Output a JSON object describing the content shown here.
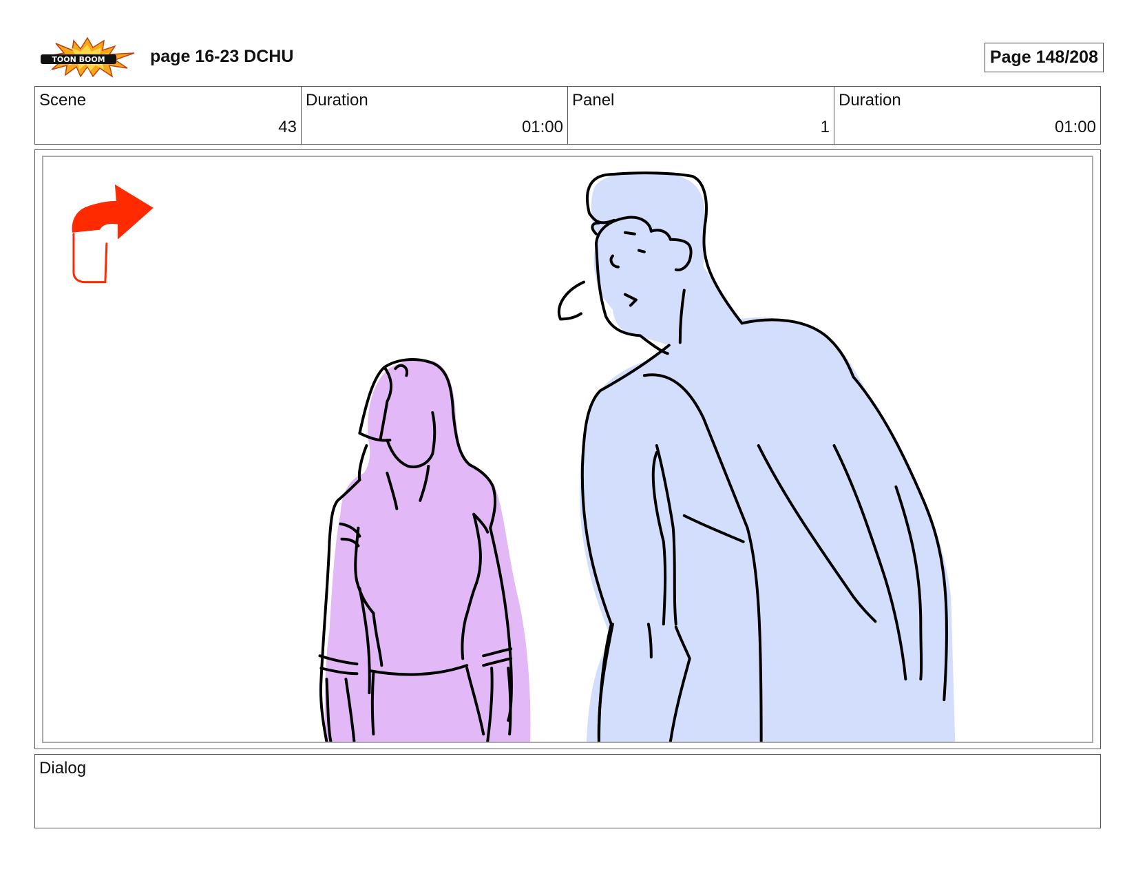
{
  "header": {
    "logo_text": "TOON BOOM",
    "title": "page 16-23 DCHU",
    "page_indicator": "Page 148/208"
  },
  "info": {
    "scene_label": "Scene",
    "scene_value": "43",
    "scene_duration_label": "Duration",
    "scene_duration_value": "01:00",
    "panel_label": "Panel",
    "panel_value": "1",
    "panel_duration_label": "Duration",
    "panel_duration_value": "01:00"
  },
  "dialog": {
    "label": "Dialog",
    "text": ""
  },
  "colors": {
    "arrow": "#ff2a00",
    "woman_fill": "#e2b9f6",
    "man_fill": "#d2defb",
    "line": "#000000"
  },
  "icons": [
    "camera-move-arrow-icon",
    "toon-boom-logo"
  ]
}
